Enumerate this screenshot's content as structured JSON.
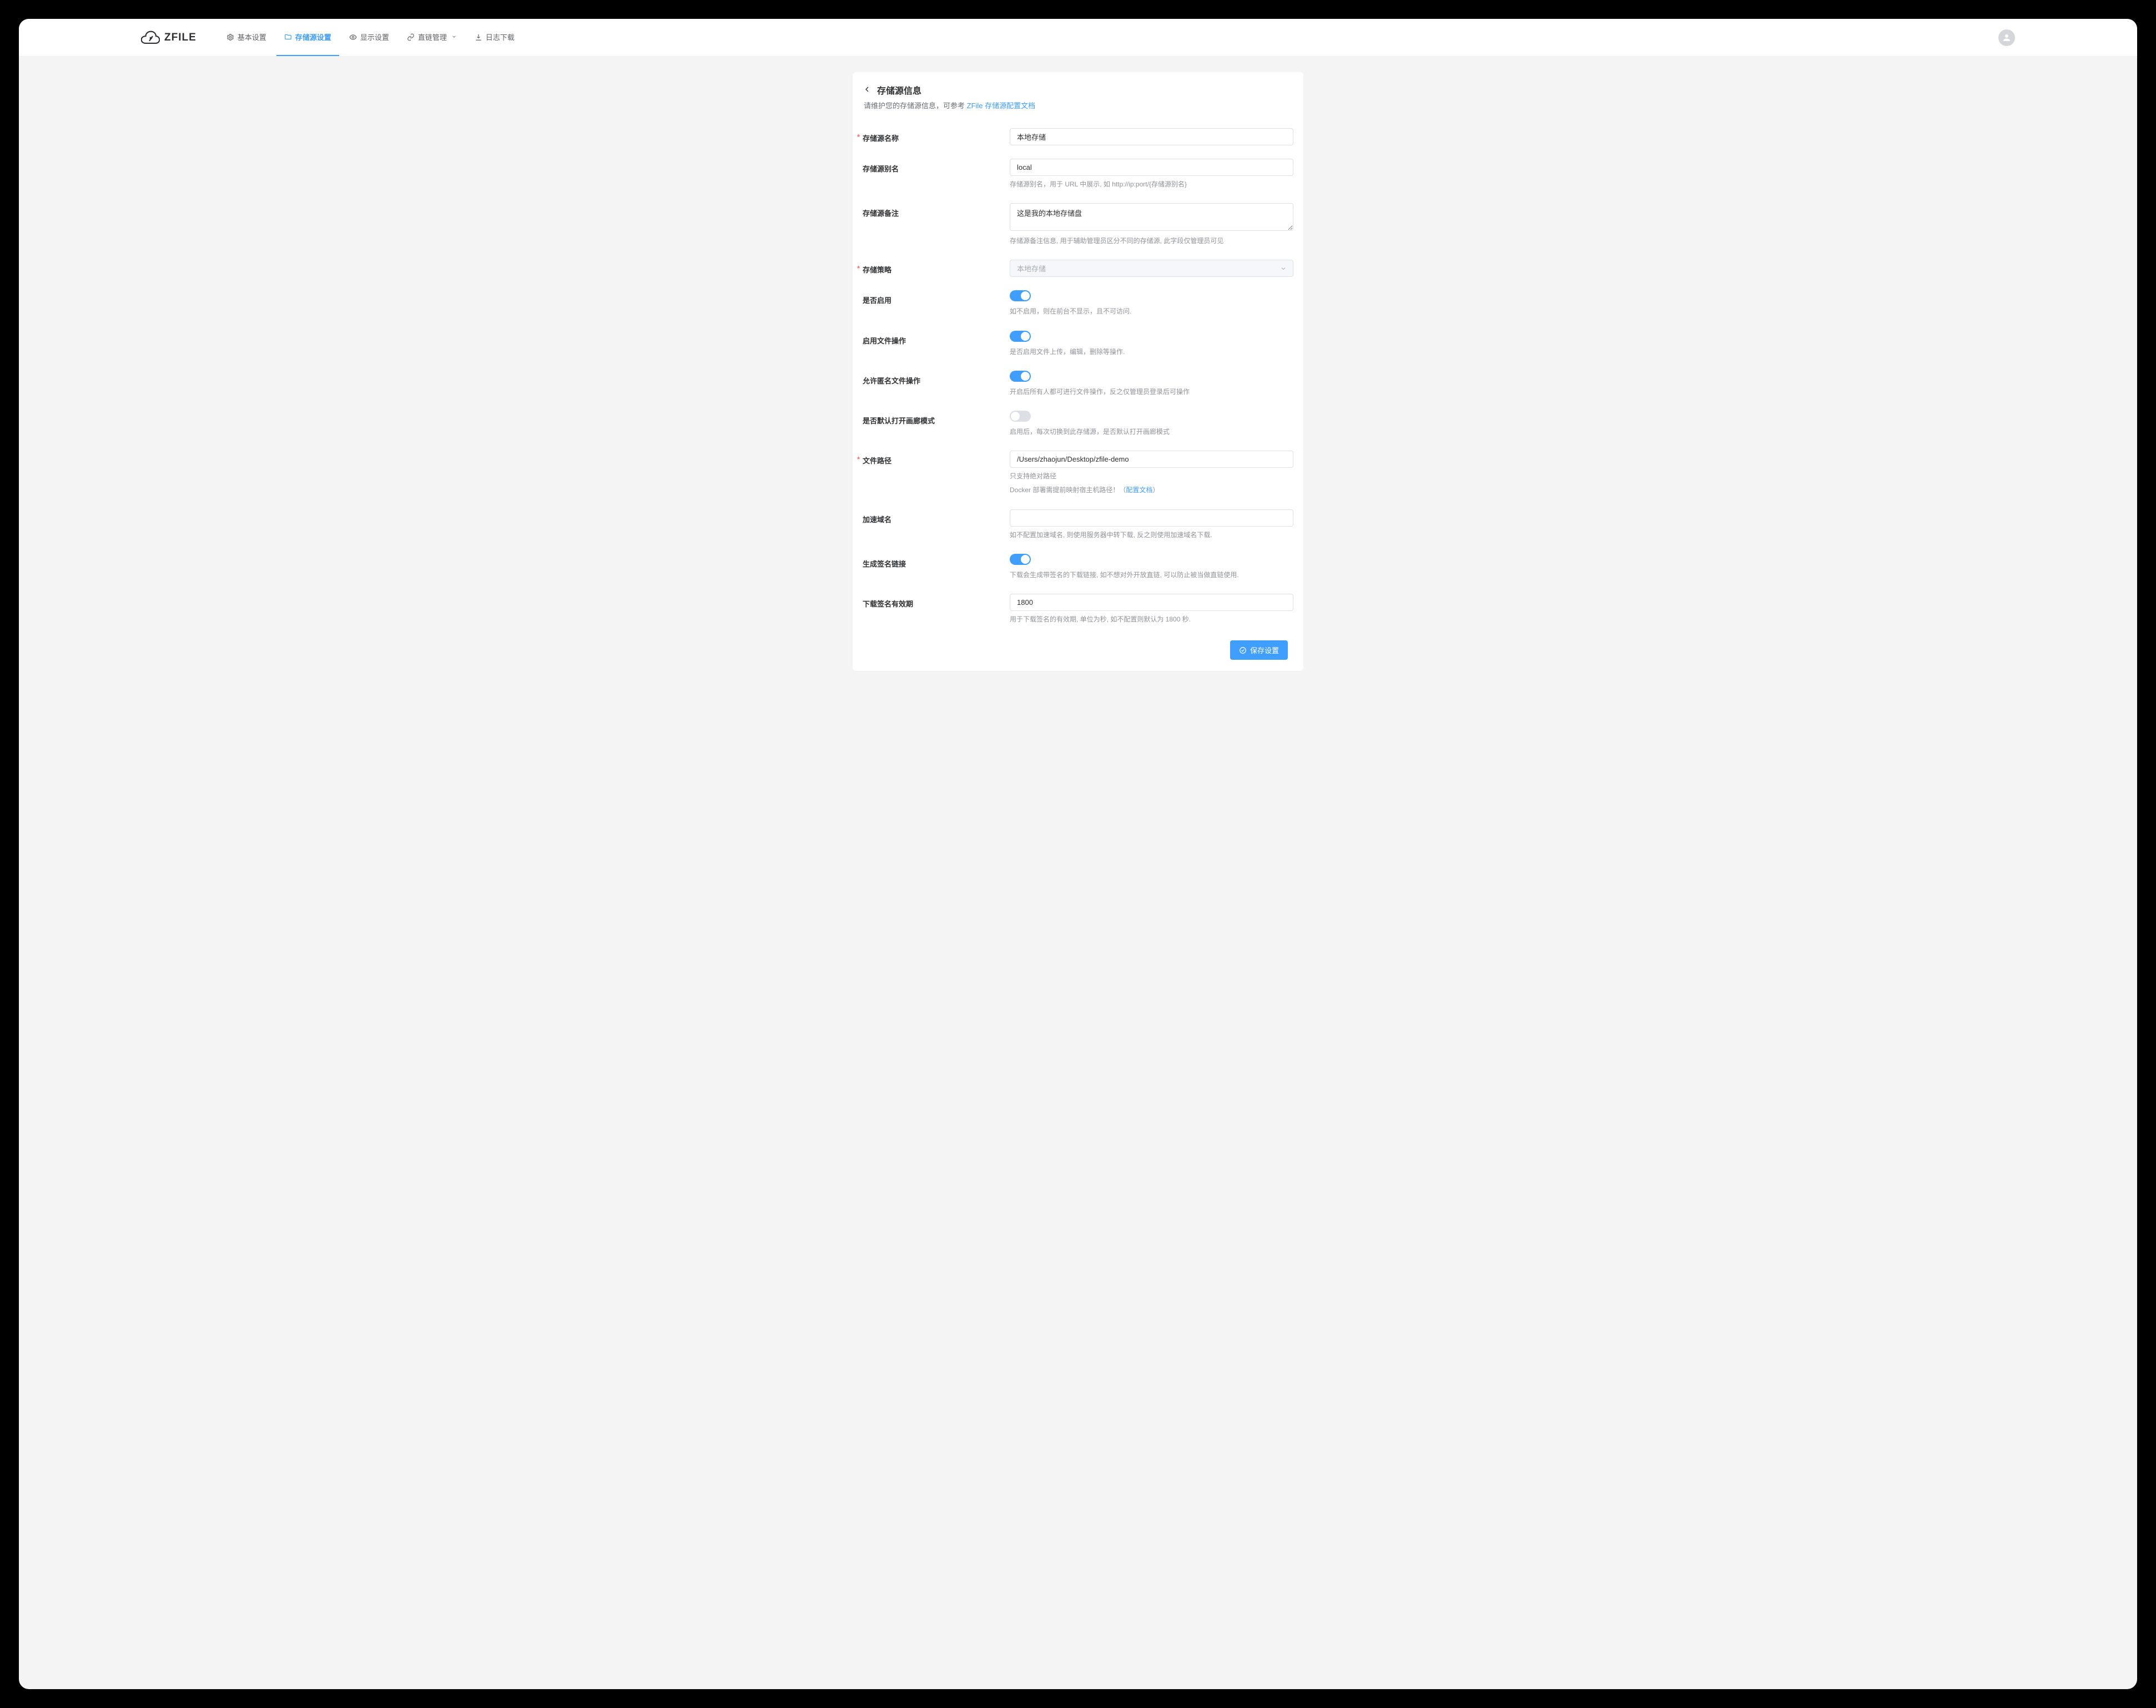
{
  "brand": "ZFILE",
  "nav": {
    "basic": "基本设置",
    "storage": "存储源设置",
    "display": "显示设置",
    "directlink": "直链管理",
    "log": "日志下载"
  },
  "page": {
    "title": "存储源信息",
    "subtitle_prefix": "请维护您的存储源信息，可参考 ",
    "subtitle_link": "ZFile 存储源配置文档"
  },
  "form": {
    "name": {
      "label": "存储源名称",
      "value": "本地存储"
    },
    "alias": {
      "label": "存储源别名",
      "value": "local",
      "help": "存储源别名，用于 URL 中展示, 如 http://ip:port/{存储源别名}"
    },
    "remark": {
      "label": "存储源备注",
      "value": "这是我的本地存储盘",
      "help": "存储源备注信息, 用于辅助管理员区分不同的存储源, 此字段仅管理员可见"
    },
    "strategy": {
      "label": "存储策略",
      "value": "本地存储"
    },
    "enable": {
      "label": "是否启用",
      "on": true,
      "help": "如不启用，则在前台不显示，且不可访问."
    },
    "fileop": {
      "label": "启用文件操作",
      "on": true,
      "help": "是否启用文件上传，编辑，删除等操作."
    },
    "anon": {
      "label": "允许匿名文件操作",
      "on": true,
      "help": "开启后所有人都可进行文件操作，反之仅管理员登录后可操作"
    },
    "gallery": {
      "label": "是否默认打开画廊模式",
      "on": false,
      "help": "启用后，每次切换到此存储源，是否默认打开画廊模式"
    },
    "path": {
      "label": "文件路径",
      "value": "/Users/zhaojun/Desktop/zfile-demo",
      "help1": "只支持绝对路径",
      "help2_prefix": "Docker 部署需提前映射宿主机路径！（",
      "help2_link": "配置文档",
      "help2_suffix": "）"
    },
    "accel": {
      "label": "加速域名",
      "value": "",
      "help": "如不配置加速域名, 则使用服务器中转下载, 反之则使用加速域名下载."
    },
    "sign": {
      "label": "生成签名链接",
      "on": true,
      "help": "下载会生成带签名的下载链接, 如不想对外开放直链, 可以防止被当做直链使用."
    },
    "expire": {
      "label": "下载签名有效期",
      "value": "1800",
      "help": "用于下载签名的有效期, 单位为秒, 如不配置则默认为 1800 秒."
    }
  },
  "save_label": "保存设置"
}
